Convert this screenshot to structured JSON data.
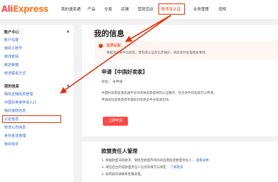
{
  "logo": {
    "part1": "Ali",
    "part2": "Express"
  },
  "nav": {
    "items": [
      {
        "label": "我的速卖通",
        "active": false
      },
      {
        "label": "产品",
        "active": false
      },
      {
        "label": "交易",
        "active": false
      },
      {
        "label": "店铺",
        "active": false
      },
      {
        "label": "营销活动",
        "active": false
      },
      {
        "label": "账号及认证",
        "active": true
      },
      {
        "label": "业务管理",
        "active": false
      },
      {
        "label": "违规",
        "active": false
      }
    ]
  },
  "sidebar": {
    "section1": "账户中心",
    "section1_items": [
      "账户设置",
      "我的子账号",
      "修改密码",
      "绑定邮箱",
      "修改联系方式"
    ],
    "section2": "我的信息",
    "section2_items": [
      "我的店铺信息管理",
      "中国好卖家申请入口",
      "我的授权信息",
      "认证信息",
      "修改公司信息",
      "身份信息管理",
      "我的信息"
    ],
    "highlighted": "中国好卖家申请入口"
  },
  "main": {
    "title": "我的信息",
    "notice_title": "重要提醒",
    "notice_text": "根据速卖通平台规定，需完成认证及信息维护，请您及时处理相关事项。",
    "apply_title": "申请【中国好卖家】",
    "status": "状态：  未申请",
    "para1": "中国好卖家是速卖通平台为优质卖家提供的认证服务，符合条件的卖家可以申请。",
    "para2": "申请成功后将获得专属标识及更多平台资源支持。",
    "apply_button": "立即申请",
    "section_title": "欧盟责任人管理",
    "list": [
      {
        "prefix": "1.",
        "text": "根据欧盟法规要求，销售至欧盟市场的商品需指定欧盟责任人，",
        "link": "查看详情"
      },
      {
        "prefix": "2.",
        "text": "请在后台完成欧盟责任人信息的填写与绑定，",
        "link": "了解更多"
      },
      {
        "prefix": "3.",
        "text": "如有疑问请联系客服处理。",
        "link": ""
      }
    ]
  },
  "colors": {
    "accent": "#e62e04",
    "brand": "#ff4747",
    "link": "#3366cc"
  }
}
